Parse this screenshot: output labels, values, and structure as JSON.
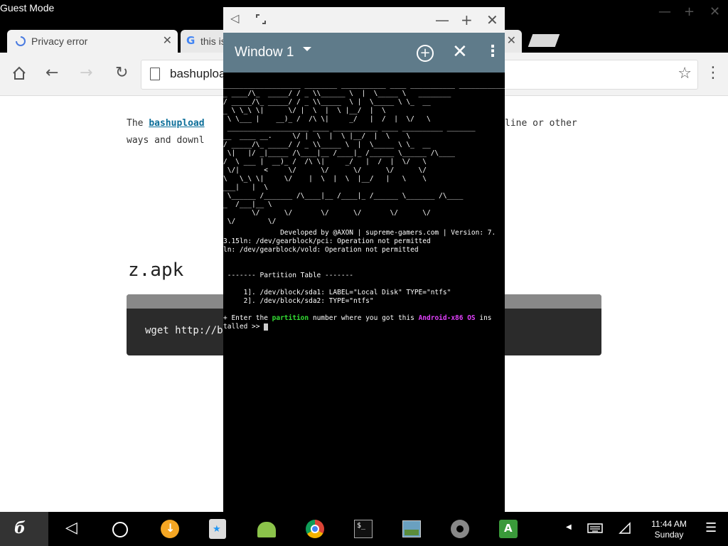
{
  "system": {
    "guest_label": "Guest Mode"
  },
  "browser": {
    "tabs": [
      {
        "label": "Privacy error",
        "active": false
      },
      {
        "label": "this is",
        "active": true
      }
    ],
    "address": "bashuploa",
    "page": {
      "intro_prefix": "The ",
      "intro_link": "bashupload",
      "intro_tail": "line or other",
      "intro_line2": "ways and downl",
      "file_heading": "z.apk",
      "code": "wget http://ba"
    }
  },
  "terminal": {
    "window_title": "Window 1",
    "banner": [
      "___________________ ________ ___________ ____ ___________ _____________",
      "_ ____/\\_  _____/ / _ \\\\______ \\  |  \\_____ \\   ________",
      "/ _____/\\_ _____/ / _ \\\\_____  \\ |  \\_____ \\ \\_  __",
      "_ \\ \\_\\ \\|      \\/ |  \\  |  \\ |__/  |  \\",
      " \\ \\___ |    __)_ /  /\\ \\|     _/   |  /  |  \\/   \\",
      " ____________________ ____ ___________ ____ __________ _______",
      "__  ____ __.     \\/ |  \\  |  \\ |__/  |  \\    \\",
      "/ _____/\\_ _____/ / _ \\\\_____ \\  |  \\_____ \\ \\_  __",
      " \\|   |/ _|_____ /\\____|__ /____|_ /______ \\______ /\\____",
      "/  \\ ___ |  __)_ /  /\\ \\|     _/   |  /  |  \\/   \\",
      " \\/|      <     \\/      \\/      \\/      \\/      \\/",
      "\\   \\_\\ \\|     \\/    |  \\  |  \\  |__/   |   \\    \\",
      "___|   |  \\",
      " \\______ /_______ /\\____|__ /____|_ /______ \\_______ /\\____",
      "_  /___|__ \\",
      "       \\/      \\/       \\/      \\/       \\/      \\/",
      " \\/        \\/"
    ],
    "lines": [
      {
        "text": "              Developed by @AXON | supreme-gamers.com | Version: 7."
      },
      {
        "text": "3.15ln: /dev/gearblock/pci: Operation not permitted"
      },
      {
        "text": "ln: /dev/gearblock/vold: Operation not permitted"
      },
      {
        "text": ""
      },
      {
        "text": ""
      },
      {
        "text": " ------- Partition Table -------"
      },
      {
        "text": ""
      },
      {
        "text": "     1]. /dev/block/sda1: LABEL=\"Local Disk\" TYPE=\"ntfs\""
      },
      {
        "text": "     2]. /dev/block/sda2: TYPE=\"ntfs\""
      },
      {
        "text": ""
      }
    ],
    "prompt": {
      "p1": "+ Enter the ",
      "kw1": "partition",
      "p2": " number where you got this ",
      "kw2": "Android-x86 OS",
      "p3": " ins",
      "line2": "talled >> "
    }
  },
  "taskbar": {
    "time": "11:44 AM",
    "day": "Sunday"
  },
  "colors": {
    "terminal_header": "#5f7b8a",
    "keyword_green": "#33dd33",
    "keyword_magenta": "#e040fb",
    "link_blue": "#0b6e99"
  }
}
